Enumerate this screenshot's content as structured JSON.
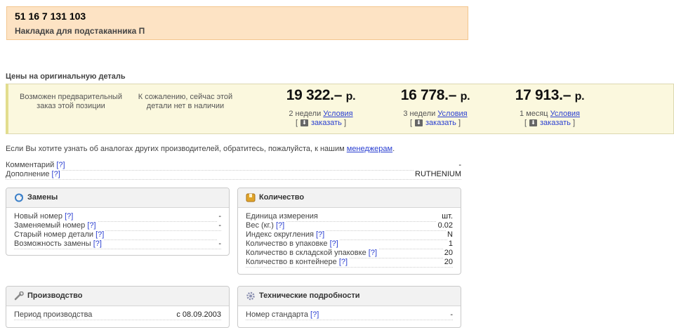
{
  "header": {
    "part_number": "51 16 7 131 103",
    "part_name": "Накладка для подстаканника П"
  },
  "prices_section_title": "Цены на оригинальную деталь",
  "price_band": {
    "preorder_text": "Возможен предварительный заказ этой позиции",
    "unavailable_text": "К сожалению, сейчас этой детали нет в наличии",
    "offers": [
      {
        "price": "19 322.–",
        "unit": "р.",
        "delivery": "2 недели",
        "conditions_label": "Условия",
        "order_label": "заказать"
      },
      {
        "price": "16 778.–",
        "unit": "р.",
        "delivery": "3 недели",
        "conditions_label": "Условия",
        "order_label": "заказать"
      },
      {
        "price": "17 913.–",
        "unit": "р.",
        "delivery": "1 месяц",
        "conditions_label": "Условия",
        "order_label": "заказать"
      }
    ],
    "bracket_open": "[",
    "bracket_close": "]"
  },
  "analog_note": {
    "text": "Если Вы хотите узнать об аналогах других производителей, обратитесь, пожалуйста, к нашим",
    "link": "менеджерам",
    "end": "."
  },
  "help_label": "[?]",
  "general_rows": [
    {
      "key": "Комментарий",
      "value": "-"
    },
    {
      "key": "Дополнение",
      "value": "RUTHENIUM"
    }
  ],
  "panels": {
    "replacements": {
      "title": "Замены",
      "icon": "refresh-icon",
      "rows": [
        {
          "key": "Новый номер",
          "value": "-"
        },
        {
          "key": "Заменяемый номер",
          "value": "-"
        },
        {
          "key": "Старый номер детали",
          "value": ""
        },
        {
          "key": "Возможность замены",
          "value": "-"
        }
      ]
    },
    "quantity": {
      "title": "Количество",
      "icon": "box-icon",
      "rows": [
        {
          "key": "Единица измерения",
          "value": "шт.",
          "help": false
        },
        {
          "key": "Вес (кг.)",
          "value": "0.02",
          "help": true
        },
        {
          "key": "Индекс округления",
          "value": "N",
          "help": true
        },
        {
          "key": "Количество в упаковке",
          "value": "1",
          "help": true
        },
        {
          "key": "Количество в складской упаковке",
          "value": "20",
          "help": true
        },
        {
          "key": "Количество в контейнере",
          "value": "20",
          "help": true
        }
      ]
    },
    "production": {
      "title": "Производство",
      "icon": "wrench-icon",
      "rows": [
        {
          "key": "Период производства",
          "value": "с 08.09.2003"
        }
      ]
    },
    "technical": {
      "title": "Технические подробности",
      "icon": "gear-icon",
      "rows": [
        {
          "key": "Номер стандарта",
          "value": "-"
        }
      ]
    }
  },
  "colors": {
    "header_bg": "#fde3c4",
    "band_bg": "#fbf8de",
    "link": "#2a3fd1"
  }
}
